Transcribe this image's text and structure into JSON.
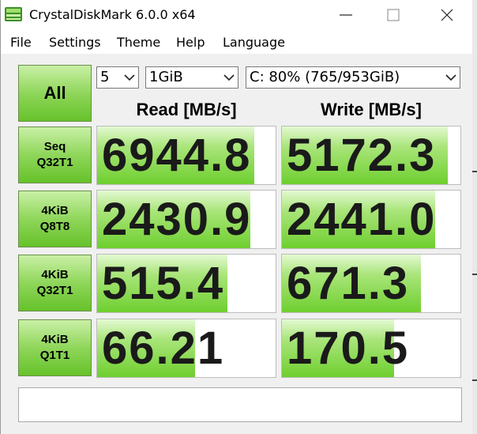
{
  "window": {
    "title": "CrystalDiskMark 6.0.0 x64"
  },
  "menu": [
    "File",
    "Settings",
    "Theme",
    "Help",
    "Language"
  ],
  "controls": {
    "all_label": "All",
    "count": "5",
    "size": "1GiB",
    "drive": "C: 80% (765/953GiB)"
  },
  "headers": {
    "read": "Read [MB/s]",
    "write": "Write [MB/s]"
  },
  "tests": [
    {
      "line1": "Seq",
      "line2": "Q32T1",
      "read": "6944.8",
      "write": "5172.3",
      "read_fill": 0.88,
      "write_fill": 0.93
    },
    {
      "line1": "4KiB",
      "line2": "Q8T8",
      "read": "2430.9",
      "write": "2441.0",
      "read_fill": 0.86,
      "write_fill": 0.86
    },
    {
      "line1": "4KiB",
      "line2": "Q32T1",
      "read": "515.4",
      "write": "671.3",
      "read_fill": 0.73,
      "write_fill": 0.78
    },
    {
      "line1": "4KiB",
      "line2": "Q1T1",
      "read": "66.21",
      "write": "170.5",
      "read_fill": 0.55,
      "write_fill": 0.63
    }
  ],
  "comment": "",
  "colors": {
    "accent_green": "#66c22a",
    "light_green": "#c9f0a6",
    "text": "#1a1a1a"
  },
  "icons": [
    "crystaldiskmark-app-icon",
    "minimize-icon",
    "maximize-icon",
    "close-icon",
    "chevron-down-icon"
  ]
}
